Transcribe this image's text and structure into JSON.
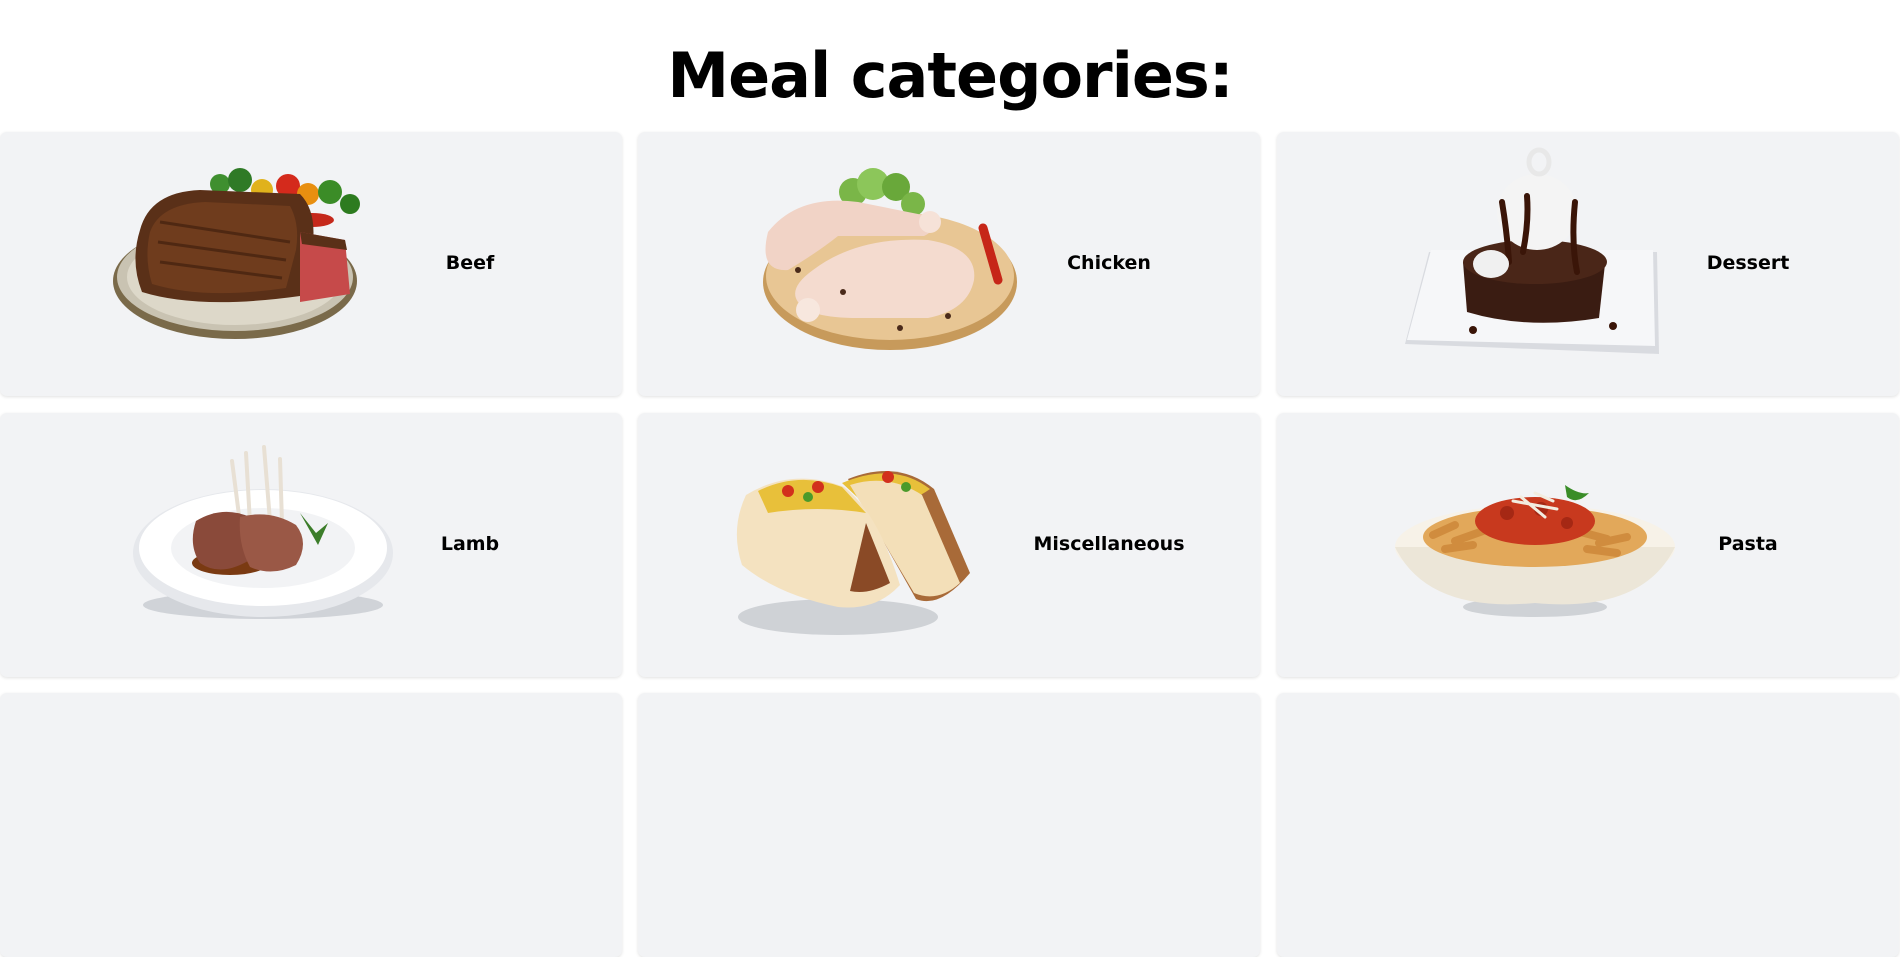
{
  "title": "Meal categories:",
  "categories": [
    {
      "label": "Beef",
      "icon": "steak-plate-icon"
    },
    {
      "label": "Chicken",
      "icon": "raw-chicken-board-icon"
    },
    {
      "label": "Dessert",
      "icon": "chocolate-cake-icon"
    },
    {
      "label": "Lamb",
      "icon": "lamb-rack-plate-icon"
    },
    {
      "label": "Miscellaneous",
      "icon": "tacos-icon"
    },
    {
      "label": "Pasta",
      "icon": "penne-bowl-icon"
    }
  ],
  "colors": {
    "card_bg": "#f2f3f5",
    "page_bg": "#ffffff",
    "text": "#000000"
  }
}
